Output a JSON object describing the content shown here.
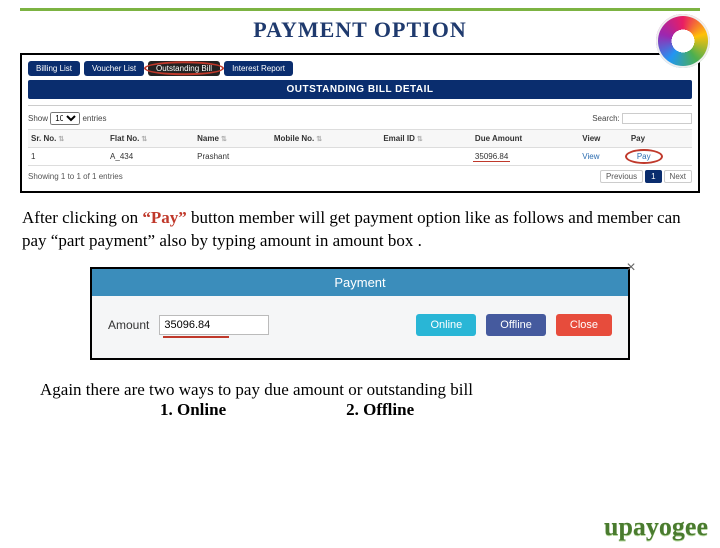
{
  "title": "PAYMENT OPTION",
  "tabs": {
    "billing": "Billing List",
    "voucher": "Voucher List",
    "outstanding": "Outstanding Bill",
    "interest": "Interest Report"
  },
  "section_header": "OUTSTANDING BILL DETAIL",
  "show": {
    "label_pre": "Show",
    "count": "10",
    "label_post": "entries"
  },
  "search": {
    "label": "Search:",
    "placeholder": ""
  },
  "columns": {
    "sr": "Sr. No.",
    "flat": "Flat No.",
    "name": "Name",
    "mobile": "Mobile No.",
    "email": "Email ID",
    "due": "Due Amount",
    "view": "View",
    "pay": "Pay"
  },
  "row": {
    "sr": "1",
    "flat": "A_434",
    "name": "Prashant",
    "mobile": "",
    "email": "",
    "due": "35096.84",
    "view": "View",
    "pay": "Pay"
  },
  "footer_info": "Showing 1 to 1 of 1 entries",
  "pager": {
    "prev": "Previous",
    "page": "1",
    "next": "Next"
  },
  "para1": {
    "pre": "After clicking on ",
    "quote": "“Pay”",
    "post": " button  member will get payment option like as follows and member can pay “part payment” also by typing amount in amount box ."
  },
  "modal": {
    "title": "Payment",
    "close": "×",
    "amount_label": "Amount",
    "amount_value": "35096.84",
    "online": "Online",
    "offline": "Offline",
    "closebtn": "Close"
  },
  "ways": {
    "line1": "Again there are two ways to pay due amount or outstanding bill",
    "opt1": "1. Online",
    "opt2": "2. Offline"
  },
  "brand": "upayogee"
}
